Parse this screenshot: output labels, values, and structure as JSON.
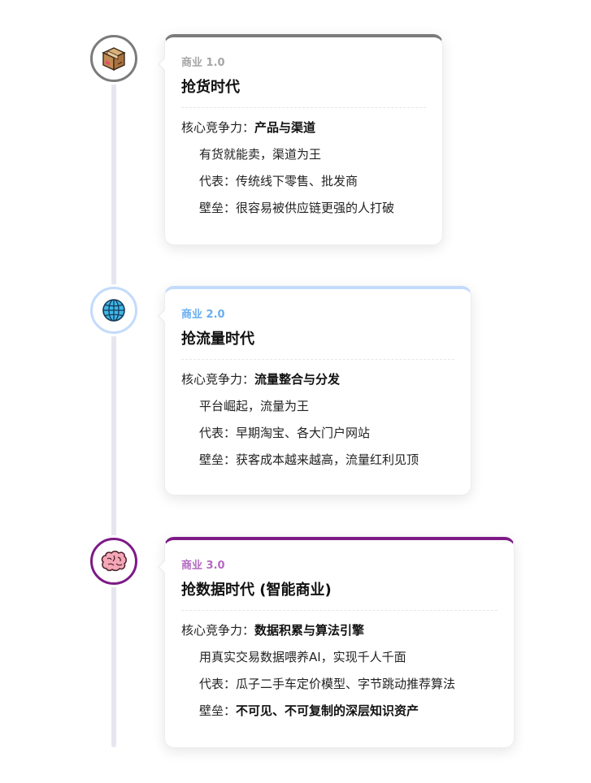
{
  "eras": [
    {
      "label": "商业 1.0",
      "title": "抢货时代",
      "core_prefix": "核心竞争力：",
      "core_value": "产品与渠道",
      "line1": "有货就能卖，渠道为王",
      "rep_prefix": "代表：",
      "rep_value": "传统线下零售、批发商",
      "barrier_prefix": "壁垒：",
      "barrier_value": "很容易被供应链更强的人打破",
      "icon": "package-box-icon",
      "accent_color": "#7b7b7b",
      "label_color": "#a6a6a6"
    },
    {
      "label": "商业 2.0",
      "title": "抢流量时代",
      "core_prefix": "核心竞争力：",
      "core_value": "流量整合与分发",
      "line1": "平台崛起，流量为王",
      "rep_prefix": "代表：",
      "rep_value": "早期淘宝、各大门户网站",
      "barrier_prefix": "壁垒：",
      "barrier_value": "获客成本越来越高，流量红利见顶",
      "icon": "globe-icon",
      "accent_color": "#c3dbfb",
      "label_color": "#68aef0"
    },
    {
      "label": "商业 3.0",
      "title": "抢数据时代 (智能商业)",
      "core_prefix": "核心竞争力：",
      "core_value": "数据积累与算法引擎",
      "line1": "用真实交易数据喂养AI，实现千人千面",
      "rep_prefix": "代表：",
      "rep_value": "瓜子二手车定价模型、字节跳动推荐算法",
      "barrier_prefix": "壁垒：",
      "barrier_value": "不可见、不可复制的深层知识资产",
      "icon": "brain-icon",
      "accent_color": "#7d1a86",
      "label_color": "#b36abf"
    }
  ]
}
